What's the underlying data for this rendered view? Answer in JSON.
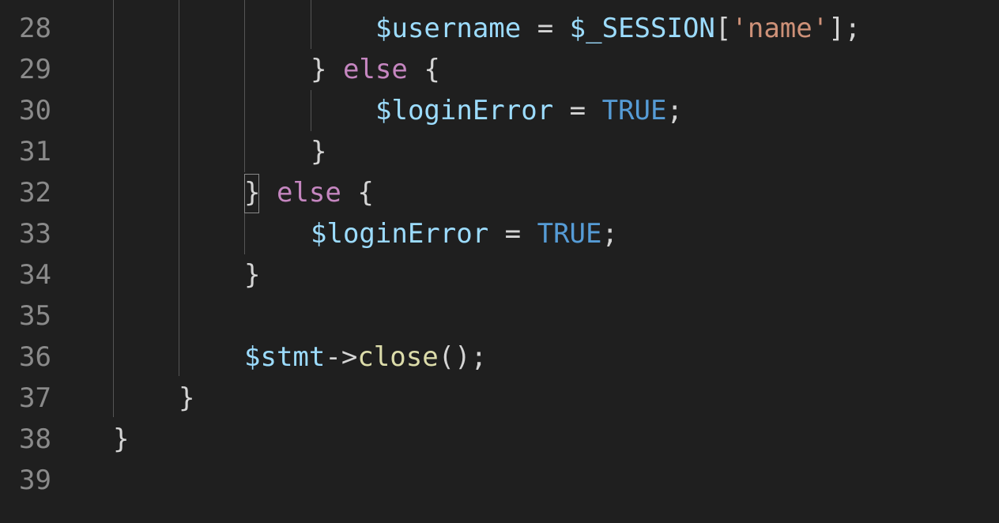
{
  "editor": {
    "language": "php",
    "theme_colors": {
      "background": "#1f1f1f",
      "line_number": "#8a8a8a",
      "variable": "#9cdcfe",
      "keyword": "#c586c0",
      "constant": "#569cd6",
      "string": "#ce9178",
      "function": "#dcdcaa",
      "punctuation": "#d4d4d4"
    },
    "lines": [
      {
        "number": "28",
        "tokens": [
          {
            "text": "$username",
            "type": "var"
          },
          {
            "text": " = ",
            "type": "op"
          },
          {
            "text": "$_SESSION",
            "type": "var"
          },
          {
            "text": "[",
            "type": "punc"
          },
          {
            "text": "'name'",
            "type": "str"
          },
          {
            "text": "];",
            "type": "punc"
          }
        ]
      },
      {
        "number": "29",
        "tokens": [
          {
            "text": "} ",
            "type": "punc"
          },
          {
            "text": "else",
            "type": "kw"
          },
          {
            "text": " {",
            "type": "punc"
          }
        ]
      },
      {
        "number": "30",
        "tokens": [
          {
            "text": "$loginError",
            "type": "var"
          },
          {
            "text": " = ",
            "type": "op"
          },
          {
            "text": "TRUE",
            "type": "const"
          },
          {
            "text": ";",
            "type": "punc"
          }
        ]
      },
      {
        "number": "31",
        "tokens": [
          {
            "text": "}",
            "type": "punc"
          }
        ]
      },
      {
        "number": "32",
        "tokens": [
          {
            "text": "}",
            "type": "punc"
          },
          {
            "text": " ",
            "type": "op"
          },
          {
            "text": "else",
            "type": "kw"
          },
          {
            "text": " {",
            "type": "punc"
          }
        ]
      },
      {
        "number": "33",
        "tokens": [
          {
            "text": "$loginError",
            "type": "var"
          },
          {
            "text": " = ",
            "type": "op"
          },
          {
            "text": "TRUE",
            "type": "const"
          },
          {
            "text": ";",
            "type": "punc"
          }
        ]
      },
      {
        "number": "34",
        "tokens": [
          {
            "text": "}",
            "type": "punc"
          }
        ]
      },
      {
        "number": "35",
        "tokens": []
      },
      {
        "number": "36",
        "tokens": [
          {
            "text": "$stmt",
            "type": "var"
          },
          {
            "text": "->",
            "type": "op"
          },
          {
            "text": "close",
            "type": "fn"
          },
          {
            "text": "();",
            "type": "punc"
          }
        ]
      },
      {
        "number": "37",
        "tokens": [
          {
            "text": "}",
            "type": "punc"
          }
        ]
      },
      {
        "number": "38",
        "tokens": [
          {
            "text": "}",
            "type": "punc"
          }
        ]
      },
      {
        "number": "39",
        "tokens": []
      }
    ]
  }
}
